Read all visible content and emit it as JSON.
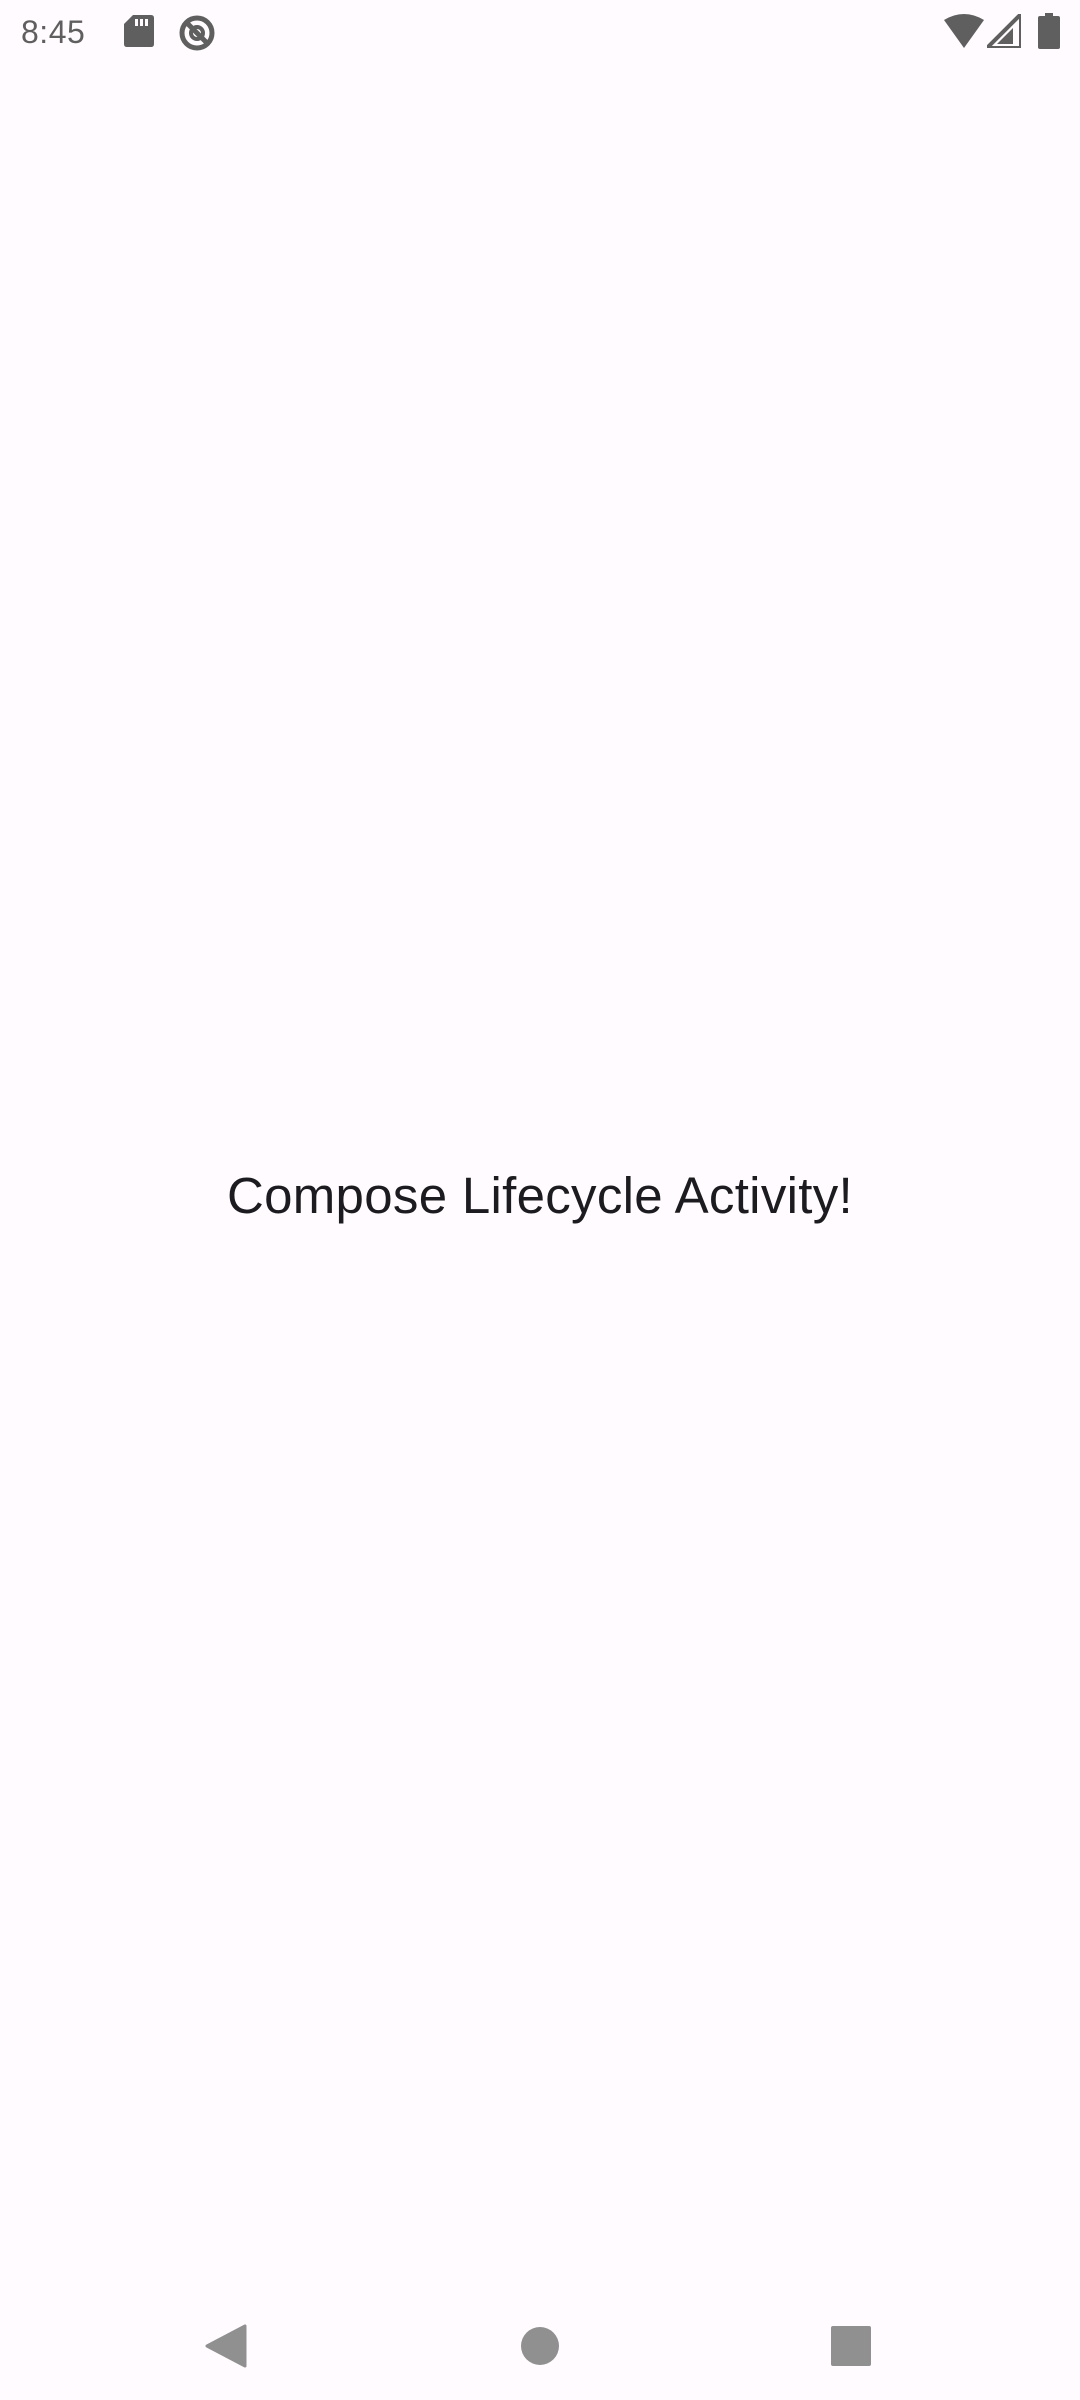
{
  "status_bar": {
    "time": "8:45",
    "icons": [
      "sd-card-icon",
      "do-not-disturb-icon",
      "wifi-icon",
      "cell-signal-icon",
      "battery-icon"
    ],
    "icon_color": "#5f5f5f"
  },
  "main": {
    "message": "Compose Lifecycle Activity!"
  },
  "nav_bar": {
    "buttons": [
      "back-icon",
      "home-icon",
      "recents-icon"
    ],
    "icon_color": "#909090"
  },
  "colors": {
    "background": "#fffbfe",
    "text": "#1c1b1f"
  }
}
